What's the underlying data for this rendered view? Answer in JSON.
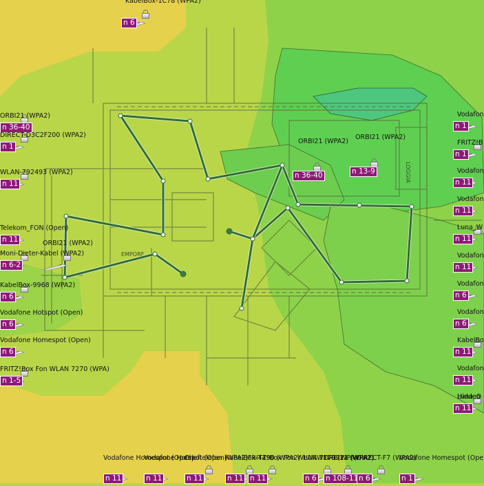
{
  "map": {
    "title": ""
  },
  "colors": {
    "yellow": "#e6d14c",
    "yellow_green": "#b9d649",
    "green": "#8ed24a",
    "bright_green": "#5fcf52",
    "deep_green": "#4ec75a",
    "badge": "#8e1a78",
    "route": "#2f6d2f"
  },
  "floorplan_labels": {
    "empore": "EMPORE",
    "loggia": "LOGGIA"
  },
  "access_points": [
    {
      "label": "KabelBox-1C78 (WPA2)",
      "badge": "n 6",
      "locked": true
    },
    {
      "label": "ORBI21 (WPA2)",
      "badge": "n 36-40",
      "locked": true
    },
    {
      "label": "DIRECT-D3C2F200 (WPA2)",
      "badge": "n 1",
      "locked": true
    },
    {
      "label": "WLAN-792493 (WPA2)",
      "badge": "n 11",
      "locked": true
    },
    {
      "label": "Telekom_FON (Open)",
      "badge": "n 11",
      "locked": false
    },
    {
      "label": "Moni-Dieter-Kabel (WPA2)",
      "badge": "n 6-2",
      "locked": true
    },
    {
      "label": "ORBI21 (WPA2)",
      "badge": "",
      "locked": true
    },
    {
      "label": "KabelBox-9968 (WPA2)",
      "badge": "n 6",
      "locked": true
    },
    {
      "label": "Vodafone Hotspot (Open)",
      "badge": "n 6",
      "locked": false
    },
    {
      "label": "Vodafone Homespot (Open)",
      "badge": "n 6",
      "locked": false
    },
    {
      "label": "FRITZ!Box Fon WLAN 7270 (WPA)",
      "badge": "n 1-5",
      "locked": true
    },
    {
      "label": "ORBI21 (WPA2)",
      "badge": "n 36-40",
      "locked": true
    },
    {
      "label": "ORBI21 (WPA2)",
      "badge": "n 13-9",
      "locked": true
    },
    {
      "label": "Vodafone",
      "badge": "n 1",
      "locked": false
    },
    {
      "label": "FRITZ!B",
      "badge": "n 1",
      "locked": true
    },
    {
      "label": "Vodafon",
      "badge": "n 11",
      "locked": false
    },
    {
      "label": "Vodafone",
      "badge": "n 11",
      "locked": false
    },
    {
      "label": "Luna_W",
      "badge": "n 11",
      "locked": true
    },
    {
      "label": "Vodafone",
      "badge": "n 11",
      "locked": false
    },
    {
      "label": "Vodafone",
      "badge": "n 6",
      "locked": false
    },
    {
      "label": "Vodafone",
      "badge": "n 6",
      "locked": false
    },
    {
      "label": "KabelBox",
      "badge": "n 11",
      "locked": true
    },
    {
      "label": "Vodafone",
      "badge": "n 11",
      "locked": false
    },
    {
      "label": "Luna_O",
      "badge": "n 11",
      "locked": true
    },
    {
      "label": "Hidden",
      "badge": "n 11",
      "locked": true
    },
    {
      "label": "Vodafone Homespot (Open)",
      "badge": "n 11",
      "locked": false
    },
    {
      "label": "Vodafone Hotspot (Open)",
      "badge": "n 11",
      "locked": false
    },
    {
      "label": "Cheftelefon (WPA2)",
      "badge": "n 11",
      "locked": true
    },
    {
      "label": "KabelBox-4490 (WPA2)",
      "badge": "n 11",
      "locked": true
    },
    {
      "label": "FRITZ!Box Fon WLAN 7170 (WPA)",
      "badge": "n 11",
      "locked": true
    },
    {
      "label": "HUAWEI-B311 (WPA2)",
      "badge": "n 6",
      "locked": true
    },
    {
      "label": "ORBI21 (WPA2)",
      "badge": "n 108-112",
      "locked": true
    },
    {
      "label": "DIRECT-F7 (WPA2)",
      "badge": "n 6",
      "locked": true
    },
    {
      "label": "Vodafone Homespot (Open)",
      "badge": "n 1",
      "locked": false
    }
  ]
}
